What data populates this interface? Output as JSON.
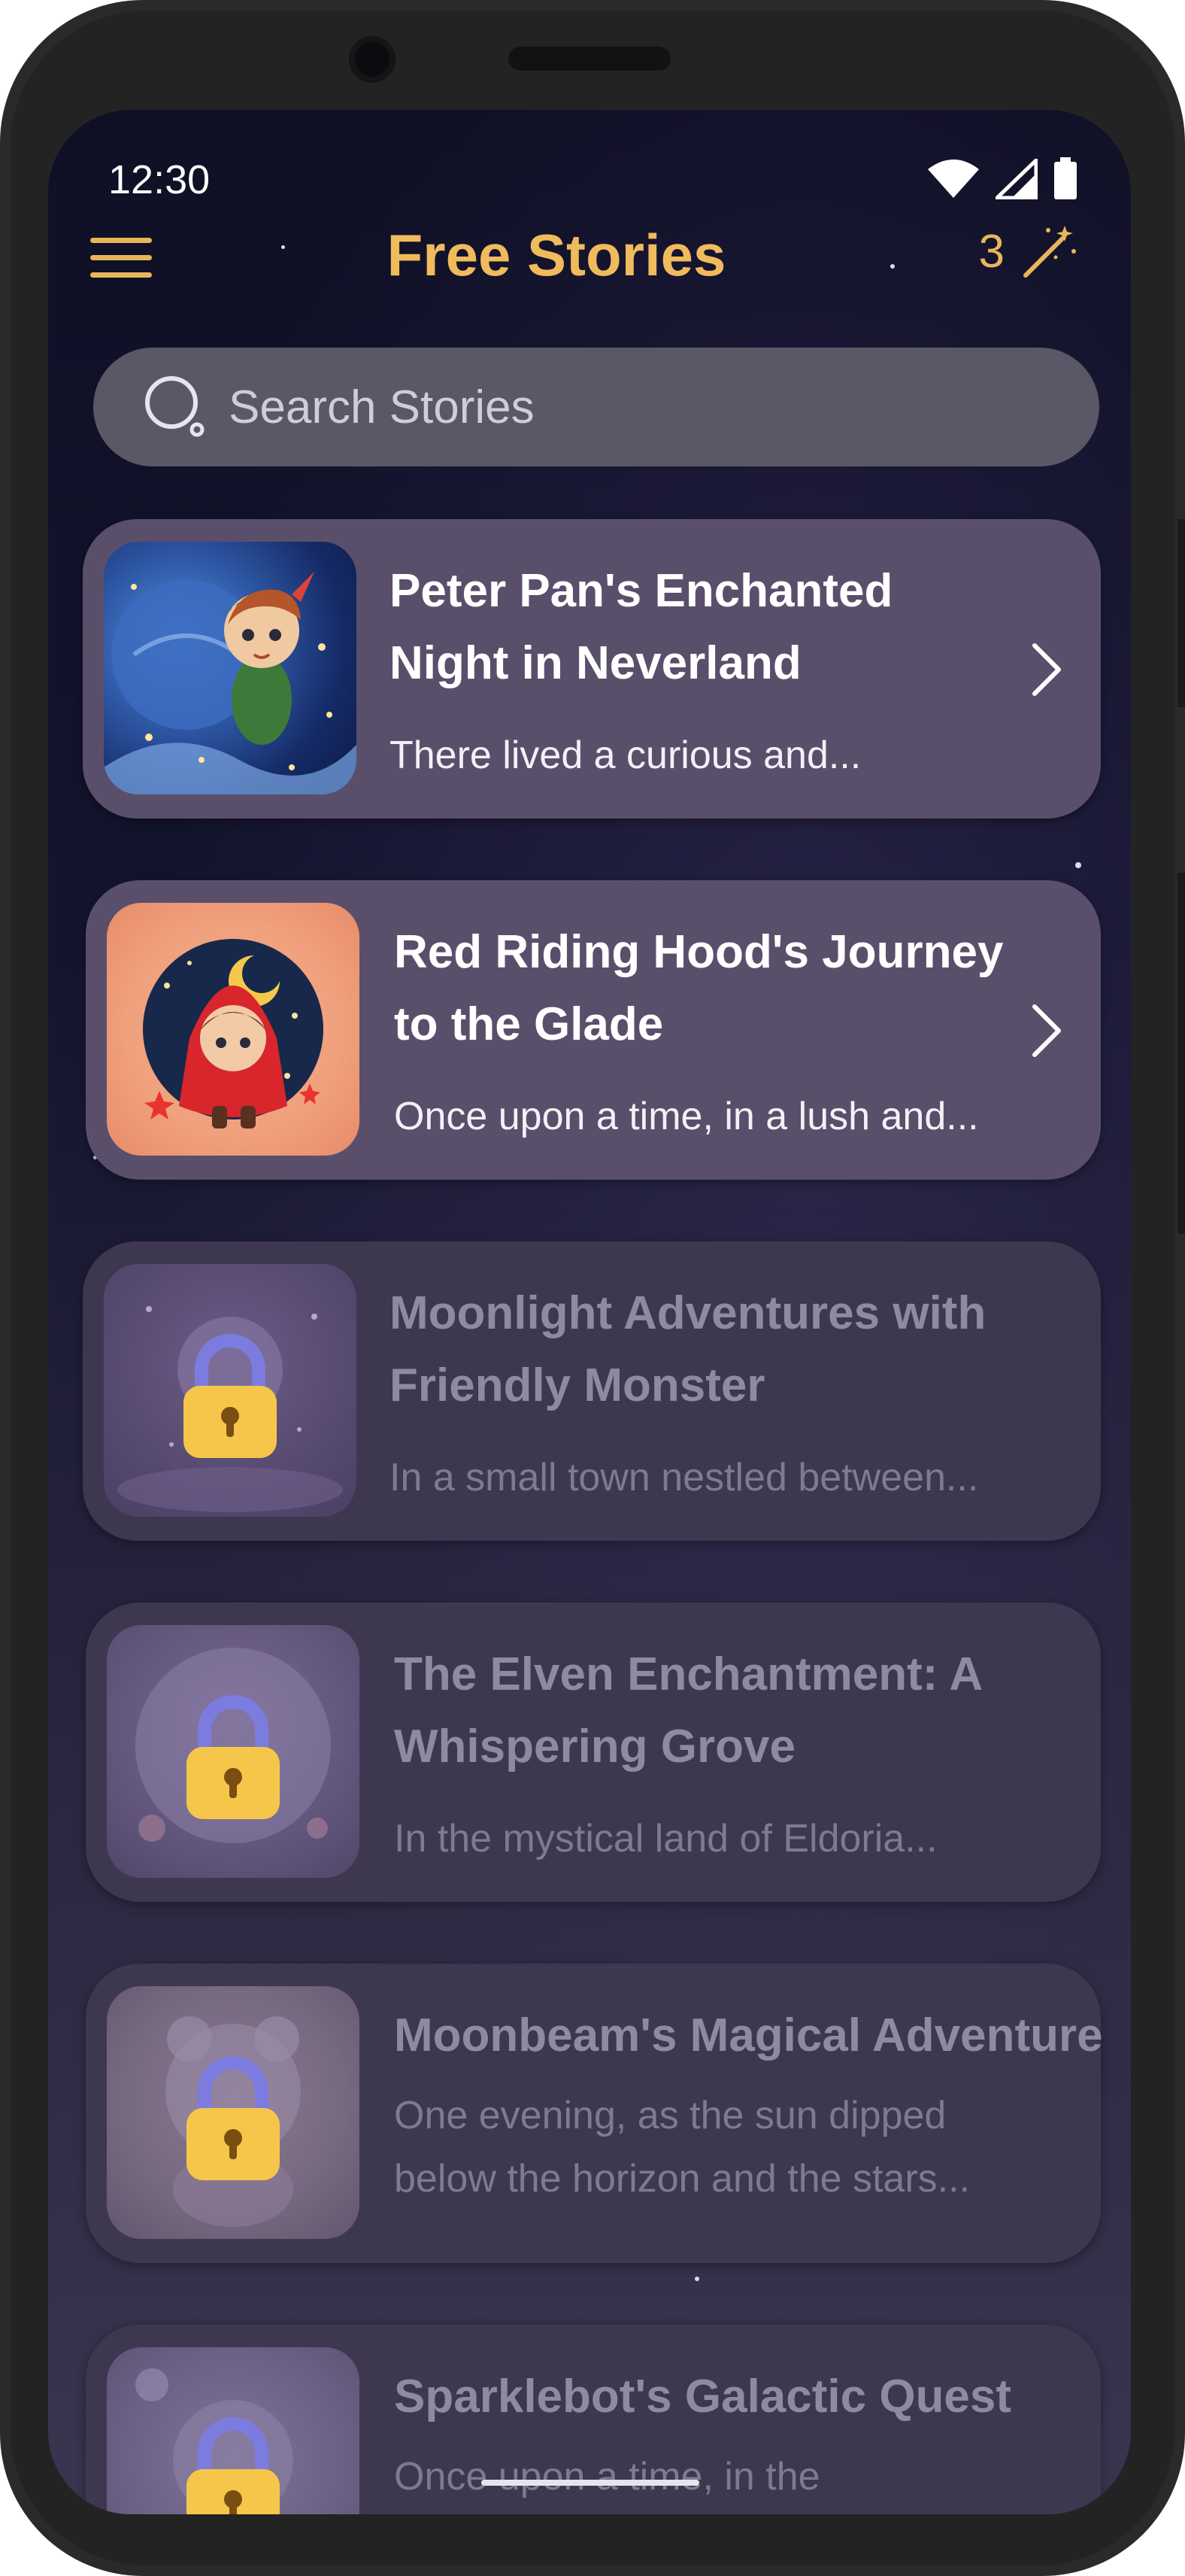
{
  "status_bar": {
    "time": "12:30"
  },
  "header": {
    "title": "Free Stories",
    "credits": "3",
    "menu_icon": "hamburger-menu-icon",
    "credits_icon": "magic-wand-icon"
  },
  "search": {
    "placeholder": "Search Stories"
  },
  "stories": [
    {
      "title": "Peter Pan's Enchanted Night in Neverland",
      "excerpt": "There lived a curious and...",
      "locked": false
    },
    {
      "title": "Red Riding Hood's Journey to the Glade",
      "excerpt": "Once upon a time, in a lush and...",
      "locked": false
    },
    {
      "title": "Moonlight Adventures with Friendly Monster",
      "excerpt": "In a small town nestled between...",
      "locked": true
    },
    {
      "title": "The Elven Enchantment: A Whispering Grove",
      "excerpt": "In the mystical land of Eldoria...",
      "locked": true
    },
    {
      "title": "Moonbeam's Magical Adventure",
      "excerpt": "One evening, as the sun dipped below the horizon and the stars...",
      "locked": true
    },
    {
      "title": "Sparklebot's Galactic Quest",
      "excerpt": "Once upon a time, in the",
      "locked": true
    }
  ],
  "colors": {
    "accent": "#f0bb5c",
    "card": "#5a4f6b",
    "card_locked": "#3d3850",
    "background": "#14142e"
  }
}
